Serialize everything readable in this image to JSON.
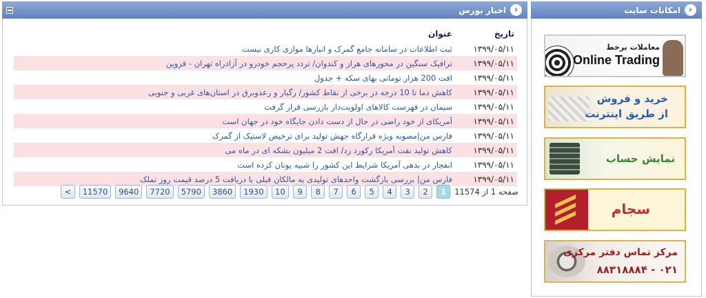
{
  "side": {
    "title": "امکانات سایت",
    "banners": {
      "online_trading": {
        "line1": "معاملات برخط",
        "line2": "Online Trading"
      },
      "internet_trade": {
        "line1": "خرید و فروش",
        "line2": "از طریق اینترنت"
      },
      "account_view": {
        "line1": "نمایش حساب"
      },
      "sajam": {
        "line1": "سجام"
      },
      "contact": {
        "line1": "مرکز تماس دفتر مرکزی",
        "line2": "۰۲۱ - ۸۸۳۱۸۸۸۴"
      }
    }
  },
  "news": {
    "title": "اخبار بورس",
    "col_date": "تاریخ",
    "col_title": "عنوان",
    "rows": [
      {
        "date": "۱۳۹۹/۰۵/۱۱",
        "title": "ثبت اطلاعات در سامانه جامع گمرک و انبارها موازی کاری نیست"
      },
      {
        "date": "۱۳۹۹/۰۵/۱۱",
        "title": "ترافیک سنگین در محورهای هراز و کندوان/ تردد پرحجم خودرو در آزادراه تهران - قزوین"
      },
      {
        "date": "۱۳۹۹/۰۵/۱۱",
        "title": "افت 200 هزار تومانی بهای سکه + جدول"
      },
      {
        "date": "۱۳۹۹/۰۵/۱۱",
        "title": "کاهش دما تا 10 درجه در برخی از نقاط کشور/ رگبار و رعدوبرق در استان‌های غربی و جنوبی"
      },
      {
        "date": "۱۳۹۹/۰۵/۱۱",
        "title": "سیمان در فهرست کالاهای اولویت‌دار بازرسی قرار گرفت"
      },
      {
        "date": "۱۳۹۹/۰۵/۱۱",
        "title": "آمریکای از خود راضی در حال از دست دادن جایگاه خود در جهان است"
      },
      {
        "date": "۱۳۹۹/۰۵/۱۱",
        "title": "فارس من|مصوبه ویژه قرارگاه جهش تولید برای ترخیص لاستیک از گمرک"
      },
      {
        "date": "۱۳۹۹/۰۵/۱۱",
        "title": "کاهش تولید نفت آمریکا رکورد زد/ افت 2 میلیون بشکه ای در ماه می"
      },
      {
        "date": "۱۳۹۹/۰۵/۱۱",
        "title": "انفجار در بدهی آمریکا شرایط این کشور را شبیه یونان کرده است"
      },
      {
        "date": "۱۳۹۹/۰۵/۱۱",
        "title": "فارس من| بررسی بازگشت واحدهای تولیدی به مالکان قبلی با دریافت 5 درصد قیمت روز تملک"
      }
    ],
    "pager": {
      "info": "صفحه 1 از 11574",
      "pages": [
        "1",
        "2",
        "3",
        "4",
        "5",
        "6",
        "7",
        "8",
        "9",
        "10",
        "1930",
        "3860",
        "5790",
        "7720",
        "9640",
        "11570",
        ">"
      ]
    }
  }
}
